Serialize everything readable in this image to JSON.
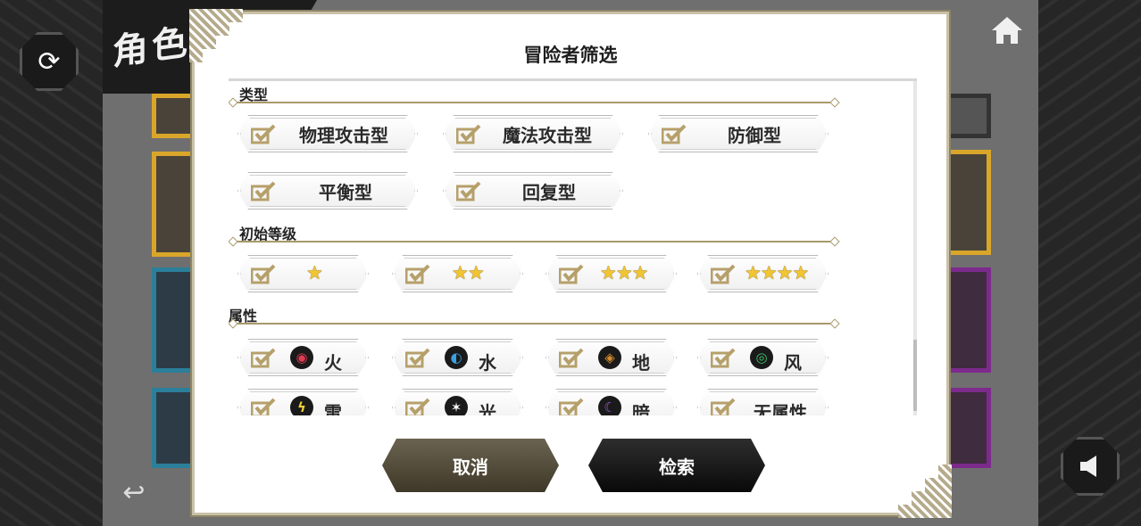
{
  "background": {
    "title": "角色一览",
    "buttons": {
      "refresh_icon": "refresh-icon",
      "home_icon": "home-icon",
      "back_icon": "back-arrow-icon",
      "sound_icon": "speaker-icon"
    }
  },
  "modal": {
    "title": "冒险者筛选",
    "sections": {
      "type": {
        "label": "类型",
        "options": [
          "物理攻击型",
          "魔法攻击型",
          "防御型",
          "平衡型",
          "回复型"
        ]
      },
      "rarity": {
        "label": "初始等级",
        "options": [
          {
            "stars": "★",
            "count": 1
          },
          {
            "stars": "★★",
            "count": 2
          },
          {
            "stars": "★★★",
            "count": 3
          },
          {
            "stars": "★★★★",
            "count": 4
          }
        ]
      },
      "element": {
        "label": "属性",
        "options": [
          {
            "label": "火",
            "icon": "fire-element-icon",
            "color": "#e03a52"
          },
          {
            "label": "水",
            "icon": "water-element-icon",
            "color": "#3aa0e0"
          },
          {
            "label": "地",
            "icon": "earth-element-icon",
            "color": "#d38b2c"
          },
          {
            "label": "风",
            "icon": "wind-element-icon",
            "color": "#3ec36a"
          },
          {
            "label": "雷",
            "icon": "thunder-element-icon",
            "color": "#f2d23a"
          },
          {
            "label": "光",
            "icon": "light-element-icon",
            "color": "#ffffff"
          },
          {
            "label": "暗",
            "icon": "dark-element-icon",
            "color": "#9b5ad6"
          },
          {
            "label": "无属性",
            "icon": "",
            "color": ""
          }
        ]
      }
    },
    "buttons": {
      "cancel": "取消",
      "search": "检索"
    }
  },
  "colors": {
    "accent": "#a8996a",
    "checkmark": "#b6a06a",
    "star": "#f2c531"
  }
}
